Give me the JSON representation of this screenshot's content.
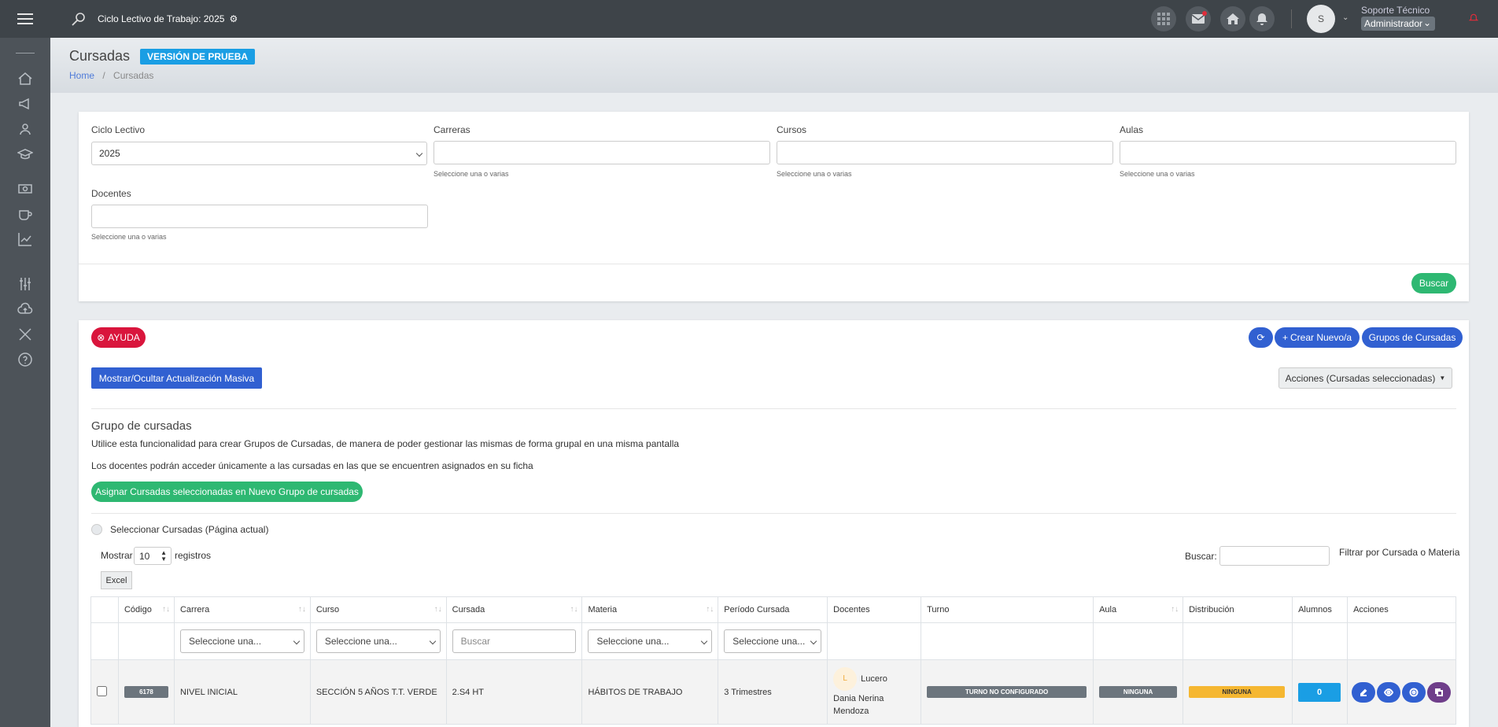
{
  "topbar": {
    "cycle_label": "Ciclo Lectivo de Trabajo: 2025",
    "user_initial": "S",
    "user_name": "Soporte Técnico",
    "user_role": "Administrador"
  },
  "header": {
    "title": "Cursadas",
    "badge": "VERSIÓN DE PRUEBA",
    "breadcrumb_home": "Home",
    "breadcrumb_sep": "/",
    "breadcrumb_current": "Cursadas"
  },
  "filters": {
    "ciclo_label": "Ciclo Lectivo",
    "ciclo_value": "2025",
    "carreras_label": "Carreras",
    "cursos_label": "Cursos",
    "aulas_label": "Aulas",
    "docentes_label": "Docentes",
    "hint": "Seleccione una o varias",
    "search_button": "Buscar"
  },
  "toolbar": {
    "help": "AYUDA",
    "create": "Crear Nuevo/a",
    "groups": "Grupos de Cursadas",
    "mass_update": "Mostrar/Ocultar Actualización Masiva",
    "actions": "Acciones (Cursadas seleccionadas)"
  },
  "group": {
    "title": "Grupo de cursadas",
    "desc1": "Utilice esta funcionalidad para crear Grupos de Cursadas, de manera de poder gestionar las mismas de forma grupal en una misma pantalla",
    "desc2": "Los docentes podrán acceder únicamente a las cursadas en las que se encuentren asignados en su ficha",
    "assign_button": "Asignar Cursadas seleccionadas en Nuevo Grupo de cursadas",
    "select_page": "Seleccionar Cursadas (Página actual)"
  },
  "list": {
    "show": "Mostrar",
    "page_size": "10",
    "records": "registros",
    "excel": "Excel",
    "search_label": "Buscar:",
    "filter_hint": "Filtrar por Cursada o Materia"
  },
  "table": {
    "headers": [
      "Código",
      "Carrera",
      "Curso",
      "Cursada",
      "Materia",
      "Período Cursada",
      "Docentes",
      "Turno",
      "Aula",
      "Distribución",
      "Alumnos",
      "Acciones"
    ],
    "filter_select": "Seleccione una...",
    "filter_search": "Buscar",
    "row": {
      "code": "6178",
      "carrera": "NIVEL INICIAL",
      "curso": "SECCIÓN 5 AÑOS T.T. VERDE",
      "cursada": "2.S4 HT",
      "materia": "HÁBITOS DE TRABAJO",
      "periodo": "3 Trimestres",
      "docente_initial": "L",
      "docente_first": "Lucero",
      "docente_rest": "Dania Nerina Mendoza",
      "turno": "TURNO NO CONFIGURADO",
      "aula": "NINGUNA",
      "distribucion": "NINGUNA",
      "alumnos": "0"
    }
  },
  "colors": {
    "green": "#2eb872",
    "blue": "#3160d1",
    "red": "#d9153c",
    "yellow": "#f5b731",
    "gray": "#6c757d",
    "sky": "#1a9ee4",
    "purple": "#6f3e8a"
  }
}
